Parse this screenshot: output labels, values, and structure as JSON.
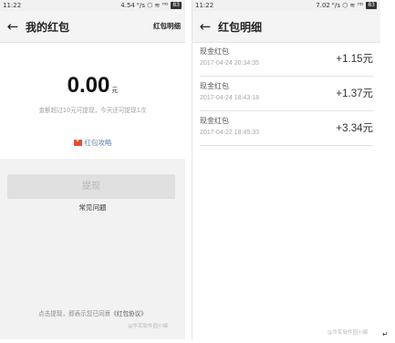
{
  "left": {
    "status": {
      "time": "11:22",
      "indicators": "4.54 ᴷ/s ⬡ ≋ ᴴᴰ",
      "battery": "83"
    },
    "title": "我的红包",
    "action": "红包明细",
    "balance": {
      "value": "0.00",
      "unit": "元"
    },
    "note": "金额超过10元可提现，今天还可提现1次",
    "strategy_link": "红包攻略",
    "withdraw_button": "提现",
    "faq_link": "常见问题",
    "agreement": {
      "prefix": "点击提现，即表示您已同意",
      "link": "《红包协议》"
    },
    "watermark": "@华军软件园小编"
  },
  "right": {
    "status": {
      "time": "11:22",
      "indicators": "7.02 ᴷ/s ⬡ ≋ ᴴᴰ",
      "battery": "83"
    },
    "title": "红包明细",
    "records": [
      {
        "name": "现金红包",
        "time": "2017-04-24 20:34:35",
        "amount": "+1.15元"
      },
      {
        "name": "现金红包",
        "time": "2017-04-24 18:43:18",
        "amount": "+1.37元"
      },
      {
        "name": "现金红包",
        "time": "2017-04-22 18:45:33",
        "amount": "+3.34元"
      }
    ],
    "watermark": "@华军软件园小编"
  },
  "colors": {
    "link_blue": "#5a7fb3",
    "envelope_red": "#e8493e",
    "appbar": "#f4f4f4"
  }
}
